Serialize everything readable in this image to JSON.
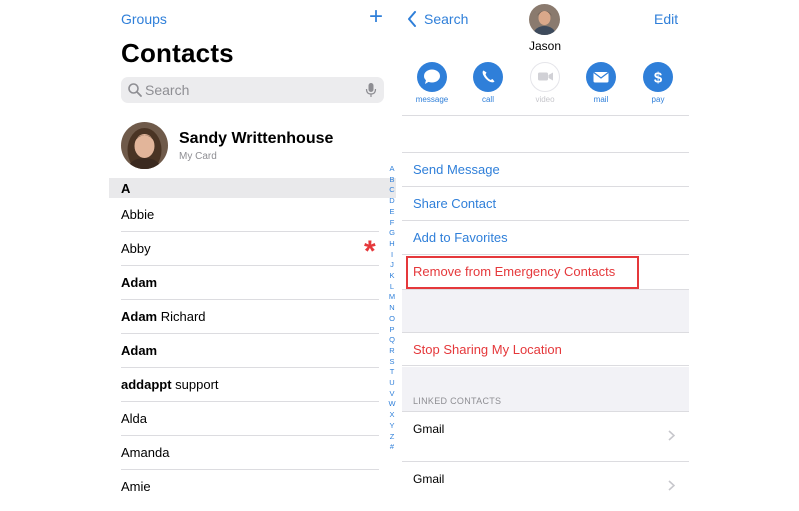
{
  "left": {
    "groups_label": "Groups",
    "plus_label": "+",
    "title": "Contacts",
    "search_placeholder": "Search",
    "my_card": {
      "name": "Sandy Writtenhouse",
      "subtitle": "My Card"
    },
    "section_letter": "A",
    "contacts": [
      {
        "first": "Abbie",
        "rest": "",
        "bold_first": false
      },
      {
        "first": "Abby",
        "rest": "",
        "bold_first": false
      },
      {
        "first": "Adam",
        "rest": "",
        "bold_first": true
      },
      {
        "first": "Adam",
        "rest": " Richard",
        "bold_first": true
      },
      {
        "first": "Adam",
        "rest": "",
        "bold_first": true
      },
      {
        "first": "addappt",
        "rest": " support",
        "bold_first": true
      },
      {
        "first": "Alda",
        "rest": "",
        "bold_first": false
      },
      {
        "first": "Amanda",
        "rest": "",
        "bold_first": false
      },
      {
        "first": "Amie",
        "rest": "",
        "bold_first": false
      }
    ],
    "annotation_mark": "*",
    "index_letters": [
      "A",
      "B",
      "C",
      "D",
      "E",
      "F",
      "G",
      "H",
      "I",
      "J",
      "K",
      "L",
      "M",
      "N",
      "O",
      "P",
      "Q",
      "R",
      "S",
      "T",
      "U",
      "V",
      "W",
      "X",
      "Y",
      "Z",
      "#"
    ]
  },
  "right": {
    "back_label": "Search",
    "edit_label": "Edit",
    "contact_name": "Jason",
    "actions": [
      {
        "label": "message",
        "icon": "message-bubble-icon",
        "enabled": true
      },
      {
        "label": "call",
        "icon": "phone-icon",
        "enabled": true
      },
      {
        "label": "video",
        "icon": "video-camera-icon",
        "enabled": false
      },
      {
        "label": "mail",
        "icon": "envelope-icon",
        "enabled": true
      },
      {
        "label": "pay",
        "icon": "dollar-icon",
        "enabled": true
      }
    ],
    "options": [
      {
        "label": "Send Message",
        "color": "blue"
      },
      {
        "label": "Share Contact",
        "color": "blue"
      },
      {
        "label": "Add to Favorites",
        "color": "blue"
      },
      {
        "label": "Remove from Emergency Contacts",
        "color": "red"
      }
    ],
    "stop_sharing_label": "Stop Sharing My Location",
    "linked_header": "LINKED CONTACTS",
    "linked": [
      {
        "label": "Gmail"
      },
      {
        "label": "Gmail"
      }
    ]
  },
  "colors": {
    "accent": "#2f7fd9",
    "destructive": "#e5383b",
    "disabled": "#c7c7cc",
    "separator": "#dcdce0",
    "grouped_bg": "#f2f2f6"
  }
}
